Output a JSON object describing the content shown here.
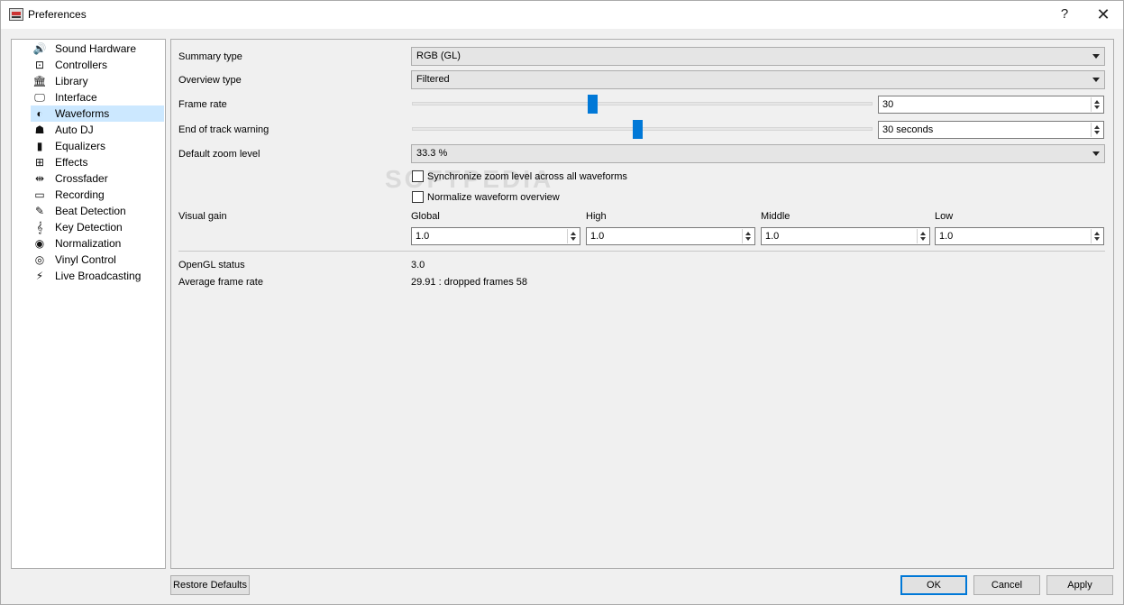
{
  "window": {
    "title": "Preferences",
    "help_label": "?",
    "close_label": "✕"
  },
  "sidebar": {
    "items": [
      {
        "label": "Sound Hardware",
        "icon": "speaker-icon",
        "glyph": "🔊",
        "selected": false
      },
      {
        "label": "Controllers",
        "icon": "controller-icon",
        "glyph": "⊡",
        "selected": false
      },
      {
        "label": "Library",
        "icon": "library-icon",
        "glyph": "🏛",
        "selected": false
      },
      {
        "label": "Interface",
        "icon": "monitor-icon",
        "glyph": "🖵",
        "selected": false
      },
      {
        "label": "Waveforms",
        "icon": "waveform-icon",
        "glyph": "◐",
        "selected": true
      },
      {
        "label": "Auto DJ",
        "icon": "robot-icon",
        "glyph": "☗",
        "selected": false
      },
      {
        "label": "Equalizers",
        "icon": "equalizer-icon",
        "glyph": "▮",
        "selected": false
      },
      {
        "label": "Effects",
        "icon": "effects-icon",
        "glyph": "⊞",
        "selected": false
      },
      {
        "label": "Crossfader",
        "icon": "crossfader-icon",
        "glyph": "⇹",
        "selected": false
      },
      {
        "label": "Recording",
        "icon": "cassette-icon",
        "glyph": "▭",
        "selected": false
      },
      {
        "label": "Beat Detection",
        "icon": "metronome-icon",
        "glyph": "✎",
        "selected": false
      },
      {
        "label": "Key Detection",
        "icon": "clef-icon",
        "glyph": "𝄞",
        "selected": false
      },
      {
        "label": "Normalization",
        "icon": "signal-icon",
        "glyph": "◉",
        "selected": false
      },
      {
        "label": "Vinyl Control",
        "icon": "vinyl-icon",
        "glyph": "◎",
        "selected": false
      },
      {
        "label": "Live Broadcasting",
        "icon": "broadcast-icon",
        "glyph": "⚡",
        "selected": false
      }
    ]
  },
  "waveforms": {
    "summary_type_label": "Summary type",
    "summary_type_value": "RGB (GL)",
    "overview_type_label": "Overview type",
    "overview_type_value": "Filtered",
    "frame_rate_label": "Frame rate",
    "frame_rate_value": "30",
    "frame_rate_slider_fraction": 0.39,
    "end_of_track_label": "End of track warning",
    "end_of_track_value": "30 seconds",
    "end_of_track_slider_fraction": 0.49,
    "zoom_label": "Default zoom level",
    "zoom_value": "33.3 %",
    "sync_zoom_label": "Synchronize zoom level across all waveforms",
    "sync_zoom_checked": false,
    "normalize_label": "Normalize waveform overview",
    "normalize_checked": false,
    "visual_gain_label": "Visual gain",
    "gains": [
      {
        "label": "Global",
        "value": "1.0"
      },
      {
        "label": "High",
        "value": "1.0"
      },
      {
        "label": "Middle",
        "value": "1.0"
      },
      {
        "label": "Low",
        "value": "1.0"
      }
    ],
    "opengl_status_label": "OpenGL status",
    "opengl_status_value": "3.0",
    "avg_frame_rate_label": "Average frame rate",
    "avg_frame_rate_value": "29.91 : dropped frames 58"
  },
  "buttons": {
    "restore_defaults": "Restore Defaults",
    "ok": "OK",
    "cancel": "Cancel",
    "apply": "Apply"
  },
  "watermark": "SOFTPEDIA"
}
